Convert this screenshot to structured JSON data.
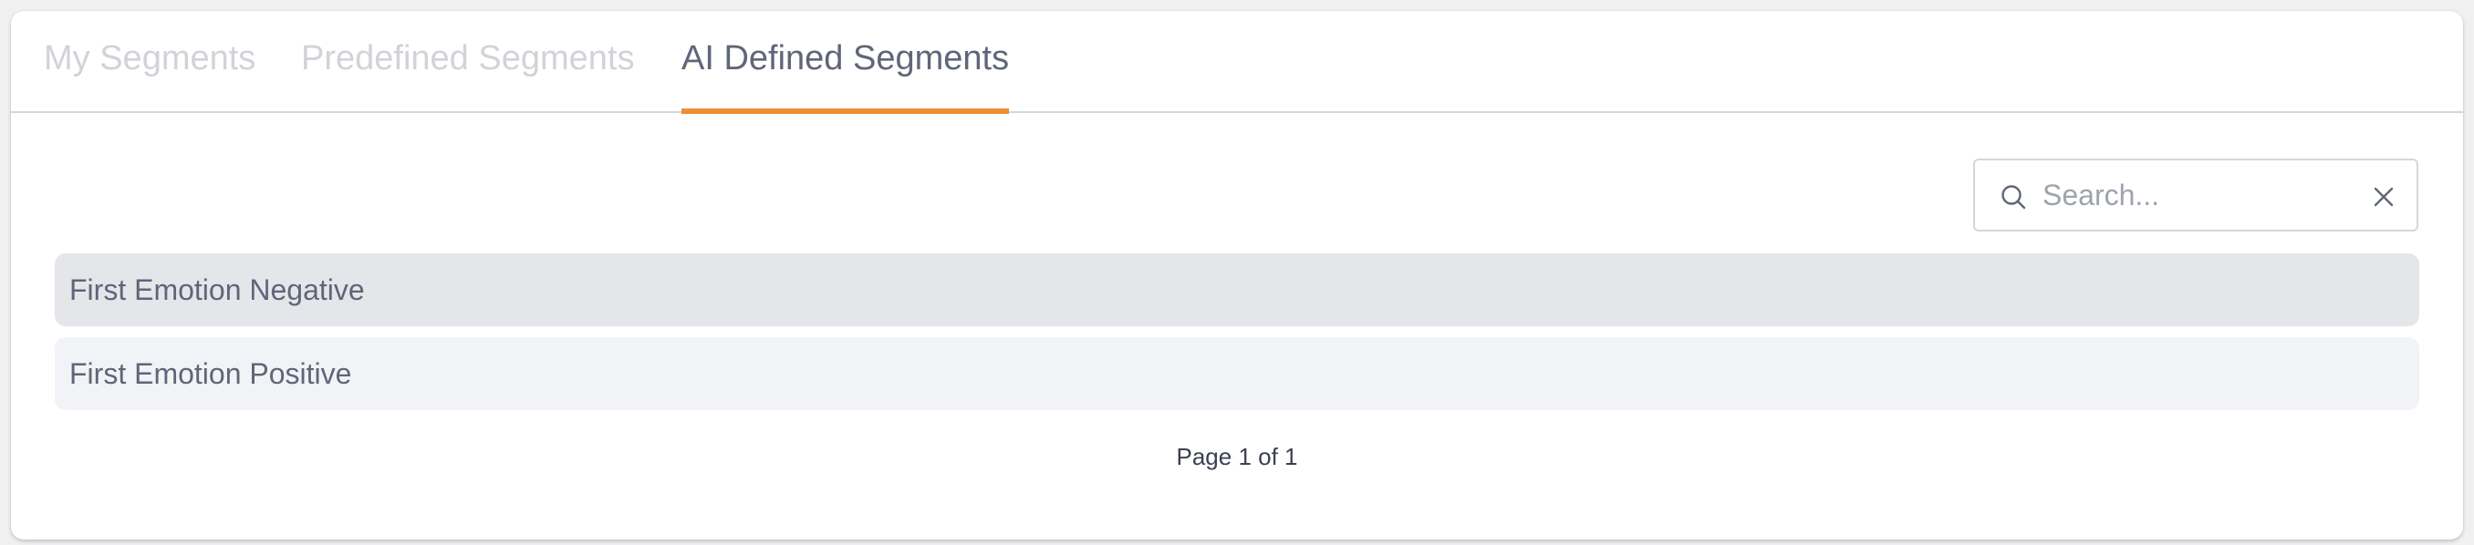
{
  "tabs": [
    {
      "label": "My Segments",
      "active": false
    },
    {
      "label": "Predefined Segments",
      "active": false
    },
    {
      "label": "AI Defined Segments",
      "active": true
    }
  ],
  "search": {
    "placeholder": "Search...",
    "value": ""
  },
  "segments": [
    {
      "name": "First Emotion Negative",
      "highlighted": true
    },
    {
      "name": "First Emotion Positive",
      "highlighted": false
    }
  ],
  "pagination": {
    "text": "Page 1 of 1"
  },
  "colors": {
    "accent": "#ed8f36",
    "active_tab_text": "#5f6679",
    "inactive_tab_text": "#d1d3d8"
  },
  "icons": {
    "search": "search-icon",
    "clear": "close-icon"
  }
}
